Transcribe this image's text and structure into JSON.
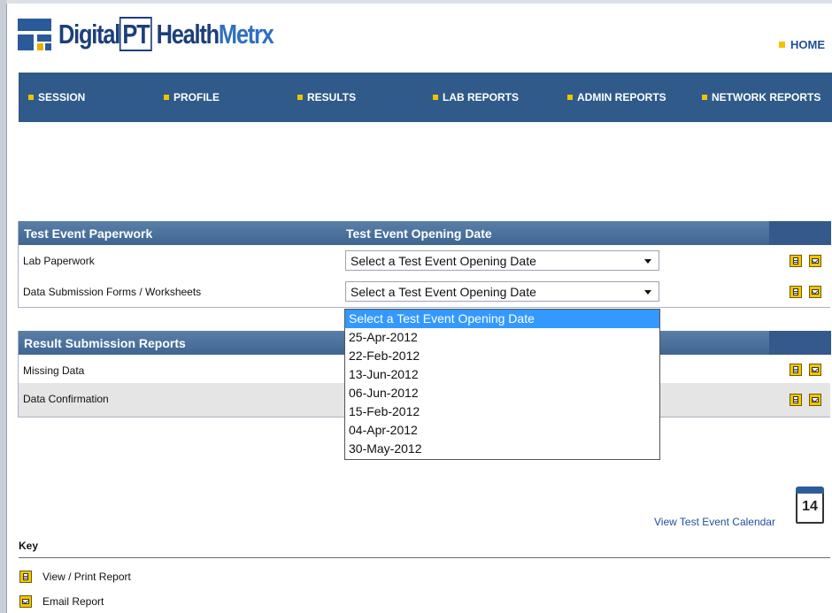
{
  "brand": {
    "part1": "Digital",
    "part2": "PT",
    "part3": "Health",
    "part4": "Metrx"
  },
  "home": "HOME",
  "nav": [
    "SESSION",
    "PROFILE",
    "RESULTS",
    "LAB REPORTS",
    "ADMIN REPORTS",
    "NETWORK REPORTS"
  ],
  "paperwork": {
    "header1": "Test Event Paperwork",
    "header2": "Test Event Opening Date",
    "rows": [
      {
        "label": "Lab Paperwork",
        "select": "Select a Test Event Opening Date"
      },
      {
        "label": "Data Submission Forms / Worksheets",
        "select": "Select a Test Event Opening Date"
      }
    ]
  },
  "dropdown_options": [
    "Select a Test Event Opening Date",
    "25-Apr-2012",
    "22-Feb-2012",
    "13-Jun-2012",
    "06-Jun-2012",
    "15-Feb-2012",
    "04-Apr-2012",
    "30-May-2012"
  ],
  "results": {
    "header1": "Result Submission Reports",
    "rows": [
      {
        "label": "Missing Data"
      },
      {
        "label": "Data Confirmation"
      }
    ]
  },
  "calendar": {
    "link": "View Test Event Calendar",
    "day": "14"
  },
  "key": {
    "title": "Key",
    "view_label": "View / Print Report",
    "email_label": "Email Report"
  },
  "colors": {
    "nav_bg": "#2f5a8a",
    "accent": "#f2c200",
    "link": "#1f4f9a"
  }
}
